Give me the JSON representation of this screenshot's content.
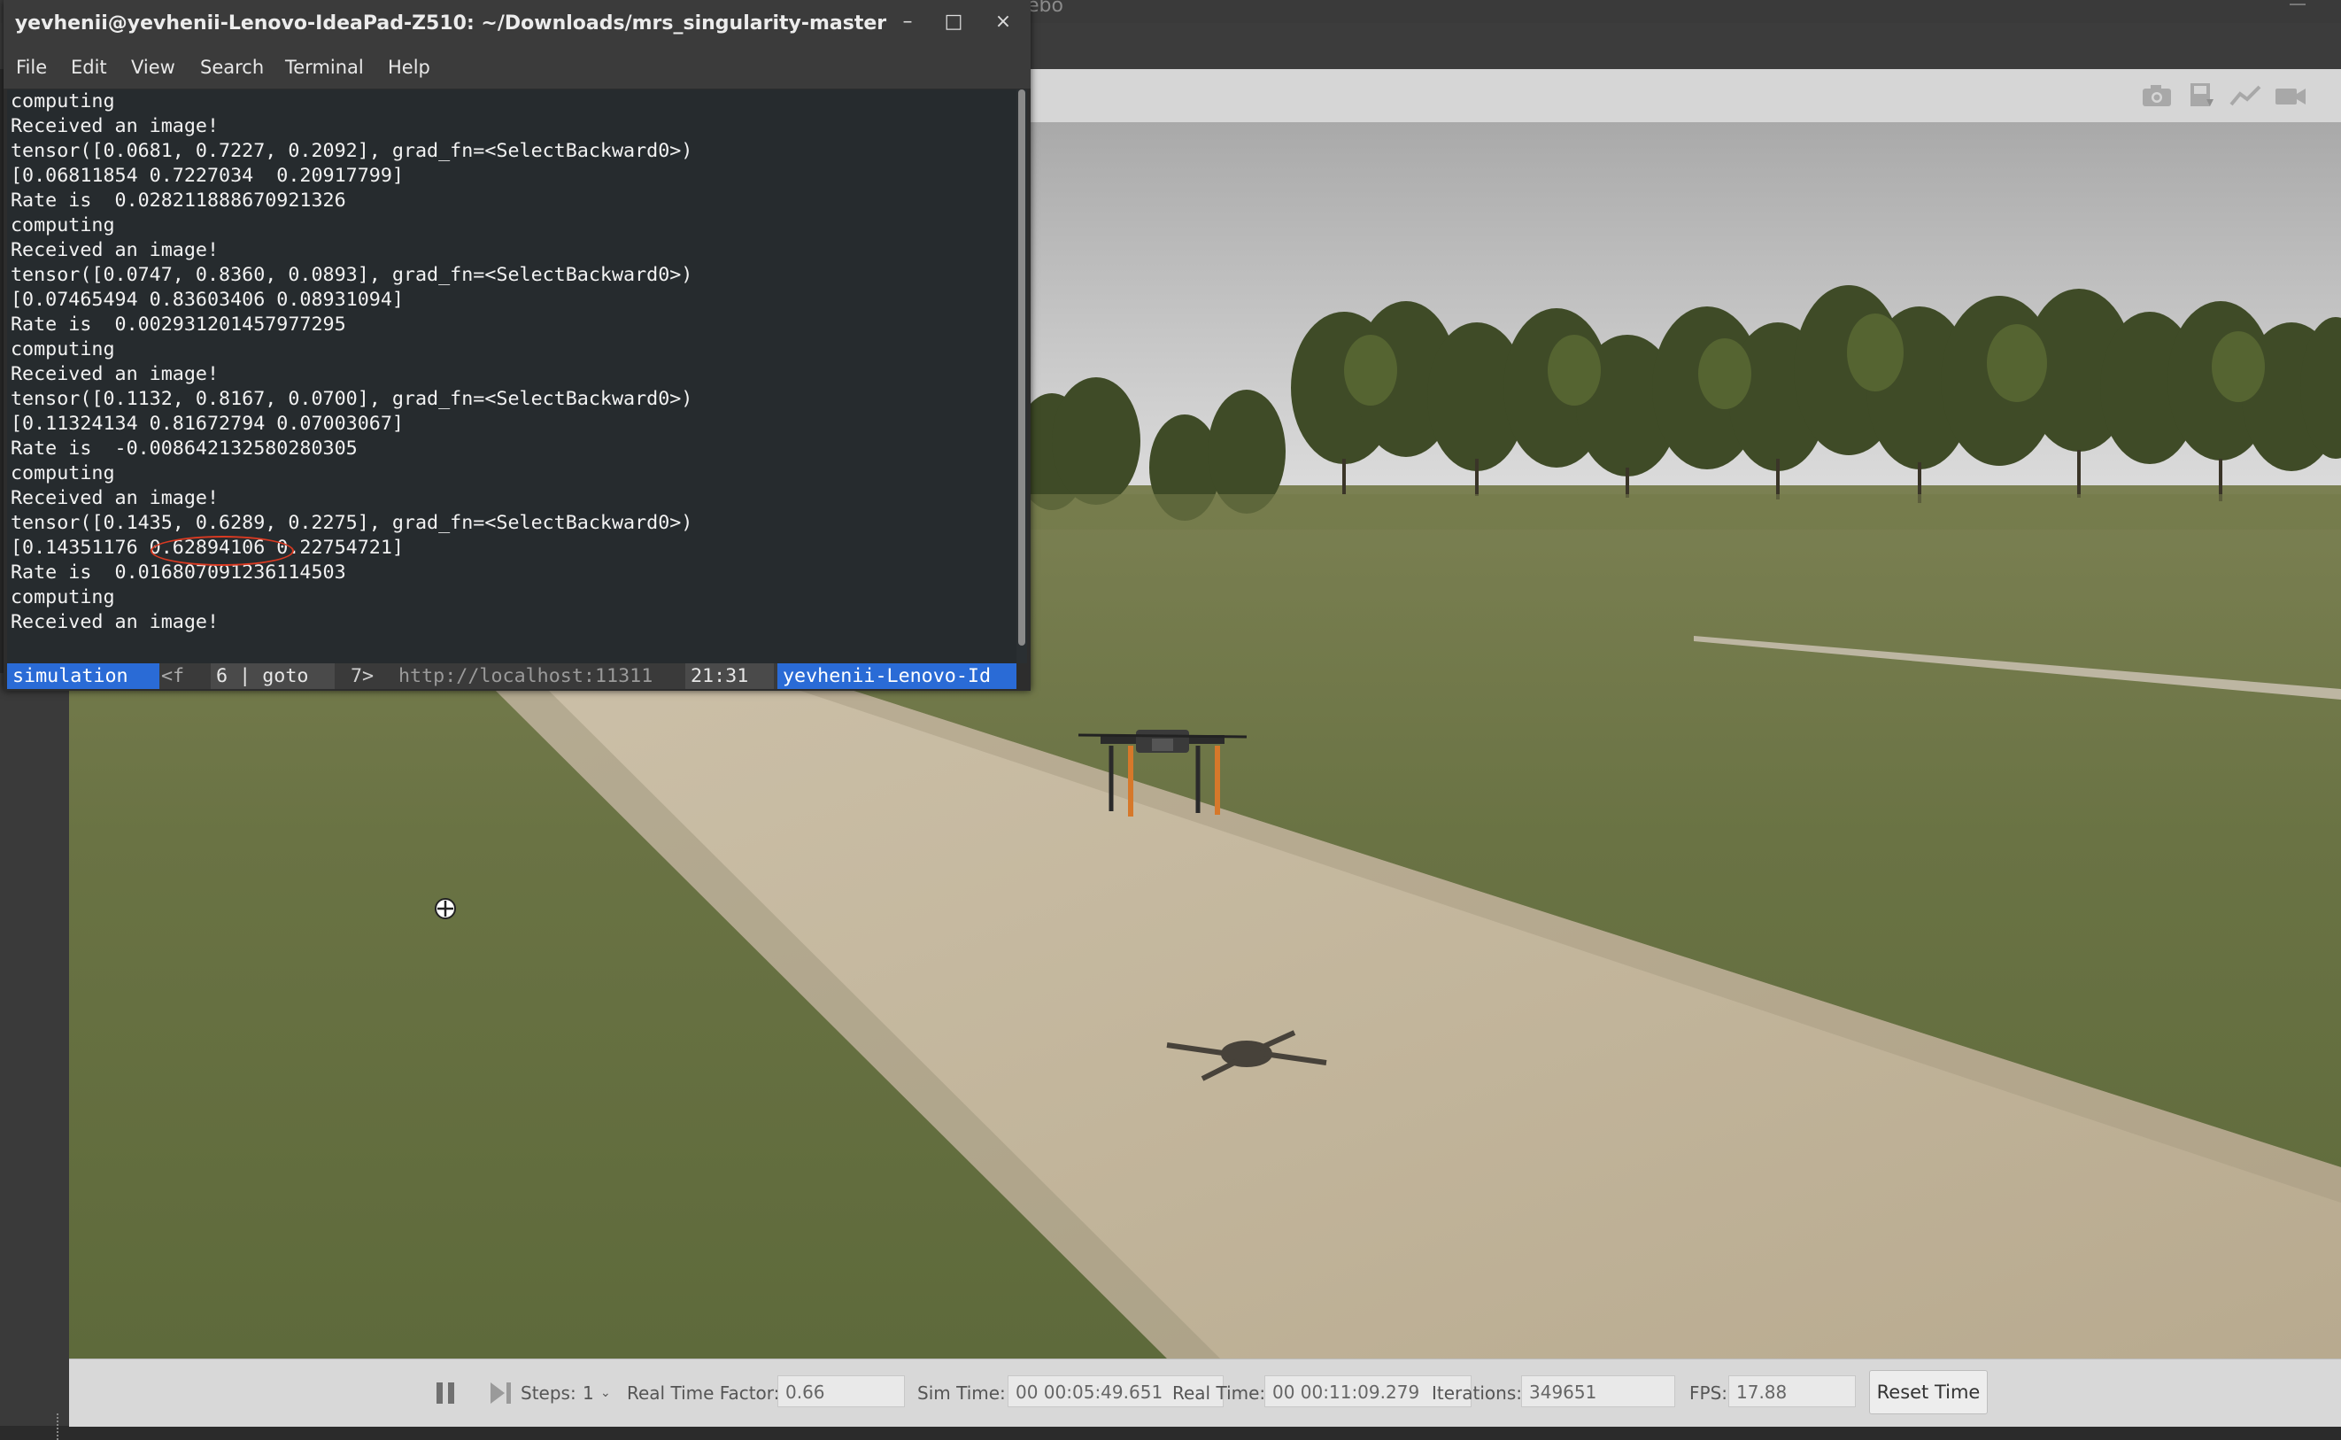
{
  "gazebo": {
    "ghost_title": "ebo",
    "toolbar_icons": [
      "camera-icon",
      "save-log-icon",
      "plot-icon",
      "video-record-icon"
    ],
    "bottom": {
      "steps_label": "Steps:",
      "steps_value": "1",
      "rtf_label": "Real Time Factor:",
      "rtf_value": "0.66",
      "sim_time_label": "Sim Time:",
      "sim_time_value": "00 00:05:49.651",
      "real_time_label": "Real Time:",
      "real_time_value": "00 00:11:09.279",
      "iterations_label": "Iterations:",
      "iterations_value": "349651",
      "fps_label": "FPS:",
      "fps_value": "17.88",
      "reset_label": "Reset Time"
    }
  },
  "terminal": {
    "title": "yevhenii@yevhenii-Lenovo-IdeaPad-Z510: ~/Downloads/mrs_singularity-master",
    "window_controls": {
      "minimize": "–",
      "maximize": "□",
      "close": "×"
    },
    "menu": [
      "File",
      "Edit",
      "View",
      "Search",
      "Terminal",
      "Help"
    ],
    "lines": [
      "computing",
      "Received an image!",
      "tensor([0.0681, 0.7227, 0.2092], grad_fn=<SelectBackward0>)",
      "[0.06811854 0.7227034  0.20917799]",
      "Rate is  0.028211888670921326",
      "computing",
      "Received an image!",
      "tensor([0.0747, 0.8360, 0.0893], grad_fn=<SelectBackward0>)",
      "[0.07465494 0.83603406 0.08931094]",
      "Rate is  0.002931201457977295",
      "computing",
      "Received an image!",
      "tensor([0.1132, 0.8167, 0.0700], grad_fn=<SelectBackward0>)",
      "[0.11324134 0.81672794 0.07003067]",
      "Rate is  -0.008642132580280305",
      "computing",
      "Received an image!",
      "tensor([0.1435, 0.6289, 0.2275], grad_fn=<SelectBackward0>)",
      "[0.14351176 0.62894106 0.22754721]",
      "Rate is  0.016807091236114503",
      "computing",
      "Received an image!"
    ],
    "tmux": {
      "session": "simulation",
      "sep1": "<f",
      "window": "6 | goto",
      "window_next": "7>",
      "url": "http://localhost:11311",
      "clock": "21:31",
      "host": "yevhenii-Lenovo-Id"
    },
    "highlight_color": "#d93a22"
  }
}
